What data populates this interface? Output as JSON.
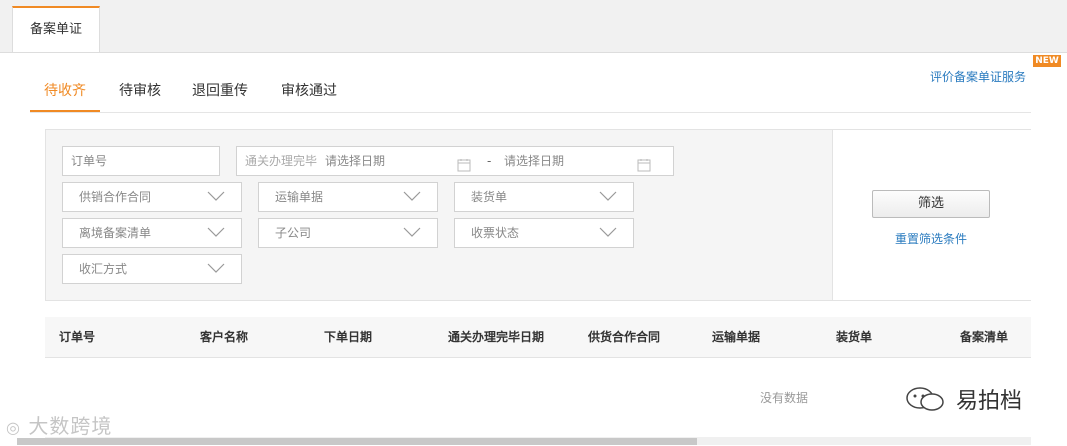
{
  "page_tab": {
    "label": "备案单证"
  },
  "top_link": {
    "label": "评价备案单证服务",
    "badge": "NEW"
  },
  "sub_tabs": [
    {
      "label": "待收齐",
      "active": true
    },
    {
      "label": "待审核",
      "active": false
    },
    {
      "label": "退回重传",
      "active": false
    },
    {
      "label": "审核通过",
      "active": false
    }
  ],
  "filters": {
    "order_no": {
      "placeholder": "订单号"
    },
    "date_range": {
      "label": "通关办理完毕",
      "start_placeholder": "请选择日期",
      "separator": "-",
      "end_placeholder": "请选择日期"
    },
    "selects": [
      {
        "label": "供销合作合同"
      },
      {
        "label": "运输单据"
      },
      {
        "label": "装货单"
      },
      {
        "label": "离境备案清单"
      },
      {
        "label": "子公司"
      },
      {
        "label": "收票状态"
      },
      {
        "label": "收汇方式"
      }
    ],
    "filter_button": "筛选",
    "reset_link": "重置筛选条件"
  },
  "table": {
    "columns": [
      "订单号",
      "客户名称",
      "下单日期",
      "通关办理完毕日期",
      "供货合作合同",
      "运输单据",
      "装货单",
      "备案清单"
    ],
    "empty_text": "没有数据"
  },
  "watermarks": {
    "left": "大数跨境",
    "right": "易拍档"
  },
  "colors": {
    "accent": "#f08a24",
    "link": "#2a7bbf"
  }
}
